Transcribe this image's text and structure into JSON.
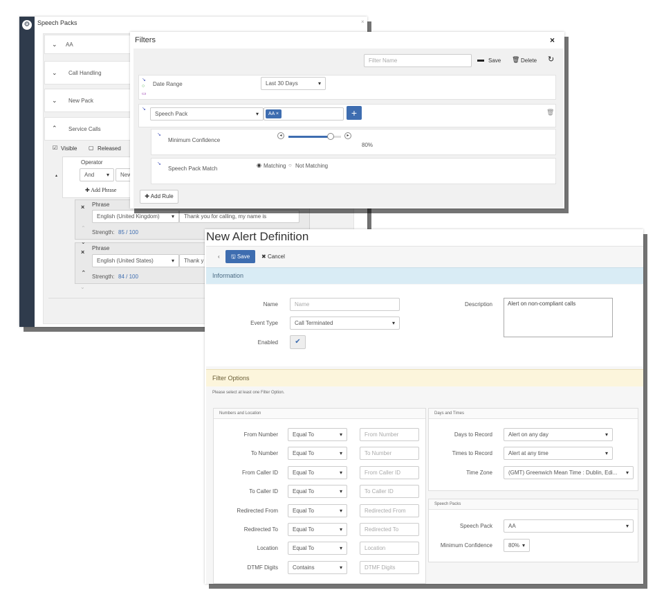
{
  "speech_packs": {
    "title": "Speech Packs",
    "packs": [
      "AA",
      "Call Handling",
      "New Pack",
      "Service Calls"
    ],
    "visible_label": "Visible",
    "released_label": "Released",
    "operator_label": "Operator",
    "operator_value": "And",
    "operator_new": "New",
    "add_phrase": "Add Phrase",
    "phrases": [
      {
        "label": "Phrase",
        "language": "English (United Kingdom)",
        "text": "Thank you for calling, my name is",
        "strength_label": "Strength:",
        "strength_value": "85 / 100"
      },
      {
        "label": "Phrase",
        "language": "English (United States)",
        "text": "Thank y",
        "strength_label": "Strength:",
        "strength_value": "84 / 100"
      }
    ]
  },
  "filters": {
    "title": "Filters",
    "filter_name_placeholder": "Filter Name",
    "save_label": "Save",
    "delete_label": "Delete",
    "date_range_label": "Date Range",
    "date_range_value": "Last 30 Days",
    "speech_pack_select": "Speech Pack",
    "speech_pack_tag": "AA",
    "min_conf_label": "Minimum Confidence",
    "min_conf_value": "80%",
    "min_conf_fraction": 0.8,
    "match_label": "Speech Pack Match",
    "matching_label": "Matching",
    "not_matching_label": "Not Matching",
    "add_rule_label": "Add Rule"
  },
  "alert": {
    "title": "New Alert Definition",
    "save_label": "Save",
    "cancel_label": "Cancel",
    "info_title": "Information",
    "name_label": "Name",
    "name_placeholder": "Name",
    "event_type_label": "Event Type",
    "event_type_value": "Call Terminated",
    "enabled_label": "Enabled",
    "description_label": "Description",
    "description_value": "Alert on non-compliant calls",
    "filter_options_title": "Filter Options",
    "filter_options_hint": "Please select at least one Filter Option.",
    "numbers_title": "Numbers and Location",
    "rows": [
      {
        "label": "From Number",
        "op": "Equal To",
        "placeholder": "From Number"
      },
      {
        "label": "To Number",
        "op": "Equal To",
        "placeholder": "To Number"
      },
      {
        "label": "From Caller ID",
        "op": "Equal To",
        "placeholder": "From Caller ID"
      },
      {
        "label": "To Caller ID",
        "op": "Equal To",
        "placeholder": "To Caller ID"
      },
      {
        "label": "Redirected From",
        "op": "Equal To",
        "placeholder": "Redirected From"
      },
      {
        "label": "Redirected To",
        "op": "Equal To",
        "placeholder": "Redirected To"
      },
      {
        "label": "Location",
        "op": "Equal To",
        "placeholder": "Location"
      },
      {
        "label": "DTMF Digits",
        "op": "Contains",
        "placeholder": "DTMF Digits"
      }
    ],
    "days_times_title": "Days and Times",
    "days_label": "Days to Record",
    "days_value": "Alert on any day",
    "times_label": "Times to Record",
    "times_value": "Alert at any time",
    "tz_label": "Time Zone",
    "tz_value": "(GMT) Greenwich Mean Time : Dublin, Edi...",
    "speech_packs_title": "Speech Packs",
    "sp_label": "Speech Pack",
    "sp_value": "AA",
    "mc_label": "Minimum Confidence",
    "mc_value": "80%"
  },
  "colors": {
    "accent": "#3e6db0",
    "info_bg": "#d9ecf5",
    "filter_bg": "#fcf5dc",
    "sidebar": "#2f3b4c"
  }
}
